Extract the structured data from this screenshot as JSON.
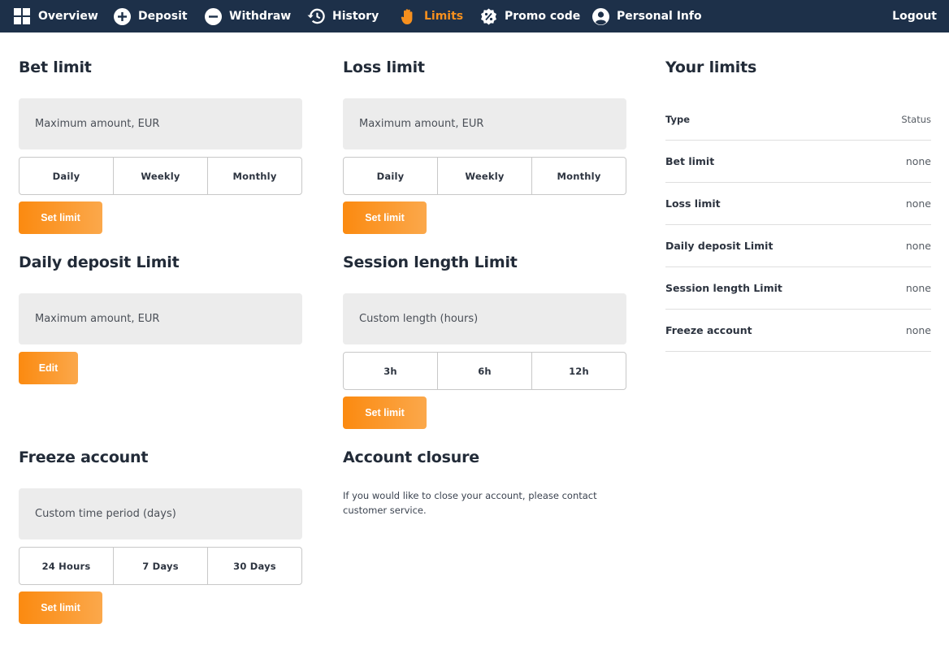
{
  "nav": {
    "items": [
      {
        "label": "Overview",
        "icon": "grid-icon"
      },
      {
        "label": "Deposit",
        "icon": "plus-circle-icon"
      },
      {
        "label": "Withdraw",
        "icon": "minus-circle-icon"
      },
      {
        "label": "History",
        "icon": "history-clock-icon"
      },
      {
        "label": "Limits",
        "icon": "hand-icon",
        "active": true
      },
      {
        "label": "Promo code",
        "icon": "promo-badge-icon"
      },
      {
        "label": "Personal Info",
        "icon": "user-circle-icon"
      }
    ],
    "logout": "Logout",
    "colors": {
      "bar": "#1d3049",
      "active": "#f7901e"
    }
  },
  "bet_limit": {
    "title": "Bet limit",
    "placeholder": "Maximum amount, EUR",
    "periods": [
      "Daily",
      "Weekly",
      "Monthly"
    ],
    "button": "Set limit"
  },
  "loss_limit": {
    "title": "Loss limit",
    "placeholder": "Maximum amount, EUR",
    "periods": [
      "Daily",
      "Weekly",
      "Monthly"
    ],
    "button": "Set limit"
  },
  "deposit_limit": {
    "title": "Daily deposit Limit",
    "placeholder": "Maximum amount, EUR",
    "button": "Edit"
  },
  "session_limit": {
    "title": "Session length Limit",
    "placeholder": "Custom length (hours)",
    "options": [
      "3h",
      "6h",
      "12h"
    ],
    "button": "Set limit"
  },
  "freeze": {
    "title": "Freeze account",
    "placeholder": "Custom time period (days)",
    "options": [
      "24 Hours",
      "7 Days",
      "30 Days"
    ],
    "button": "Set limit"
  },
  "closure": {
    "title": "Account closure",
    "text": "If you would like to close your account, please contact customer service."
  },
  "your_limits": {
    "title": "Your limits",
    "header": {
      "type": "Type",
      "status": "Status"
    },
    "rows": [
      {
        "type": "Bet limit",
        "status": "none"
      },
      {
        "type": "Loss limit",
        "status": "none"
      },
      {
        "type": "Daily deposit Limit",
        "status": "none"
      },
      {
        "type": "Session length Limit",
        "status": "none"
      },
      {
        "type": "Freeze account",
        "status": "none"
      }
    ]
  },
  "accent_gradient": [
    "#fb8a10",
    "#fba84b"
  ]
}
